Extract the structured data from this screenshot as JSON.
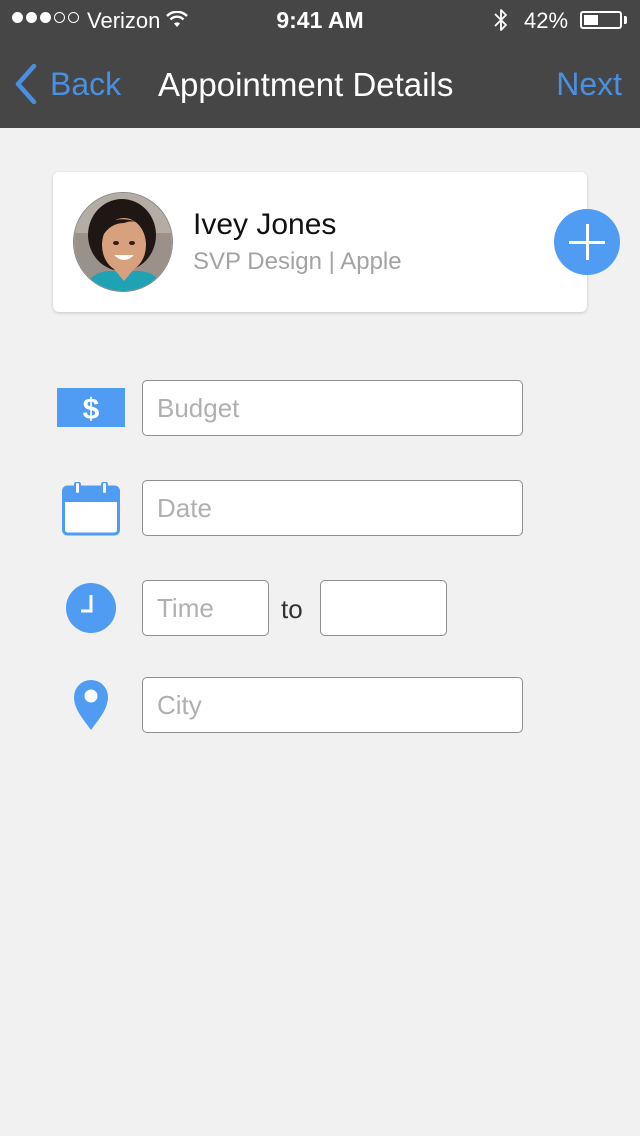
{
  "status_bar": {
    "carrier": "Verizon",
    "time": "9:41 AM",
    "battery_percent": "42%",
    "battery_level": 0.42,
    "signal_bars_filled": 3,
    "signal_bars_total": 5
  },
  "nav": {
    "back_label": "Back",
    "title": "Appointment Details",
    "next_label": "Next"
  },
  "contact": {
    "name": "Ivey Jones",
    "subtitle": "SVP Design | Apple"
  },
  "form": {
    "budget": {
      "placeholder": "Budget",
      "value": ""
    },
    "date": {
      "placeholder": "Date",
      "value": ""
    },
    "time_start": {
      "placeholder": "Time",
      "value": ""
    },
    "to_label": "to",
    "time_end": {
      "placeholder": "",
      "value": ""
    },
    "city": {
      "placeholder": "City",
      "value": ""
    }
  },
  "icons": {
    "budget": "dollar-icon",
    "date": "calendar-icon",
    "time": "clock-icon",
    "city": "location-pin-icon",
    "add": "plus-icon",
    "back": "chevron-left-icon"
  },
  "colors": {
    "accent": "#4a90e2",
    "icon_blue": "#4f9cf2",
    "nav_background": "#464646",
    "page_background": "#f1f1f1"
  }
}
